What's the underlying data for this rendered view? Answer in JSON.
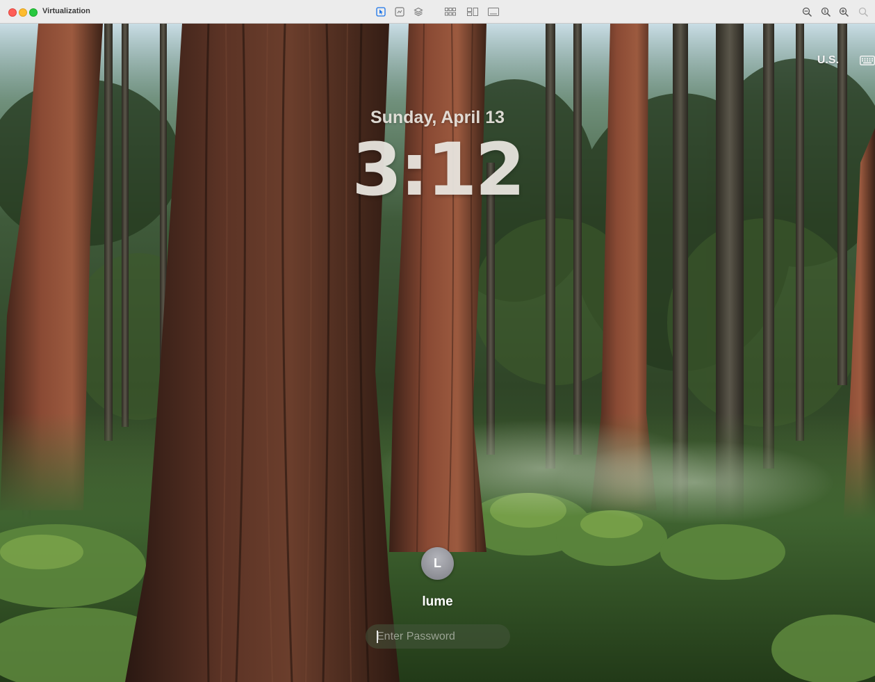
{
  "window": {
    "title": "Virtualization"
  },
  "toolbar": {
    "icons": [
      "pointer-icon",
      "screenshot-icon",
      "layers-icon",
      "grid-icon",
      "windows-icon",
      "display-icon",
      "zoom-out-icon",
      "zoom-actual-icon",
      "zoom-in-icon",
      "zoom-fit-icon"
    ]
  },
  "lockscreen": {
    "input_source": "U.S.",
    "date": "Sunday, April 13",
    "time": "3:12",
    "avatar_initial": "L",
    "username": "lume",
    "password_placeholder": "Enter Password"
  }
}
